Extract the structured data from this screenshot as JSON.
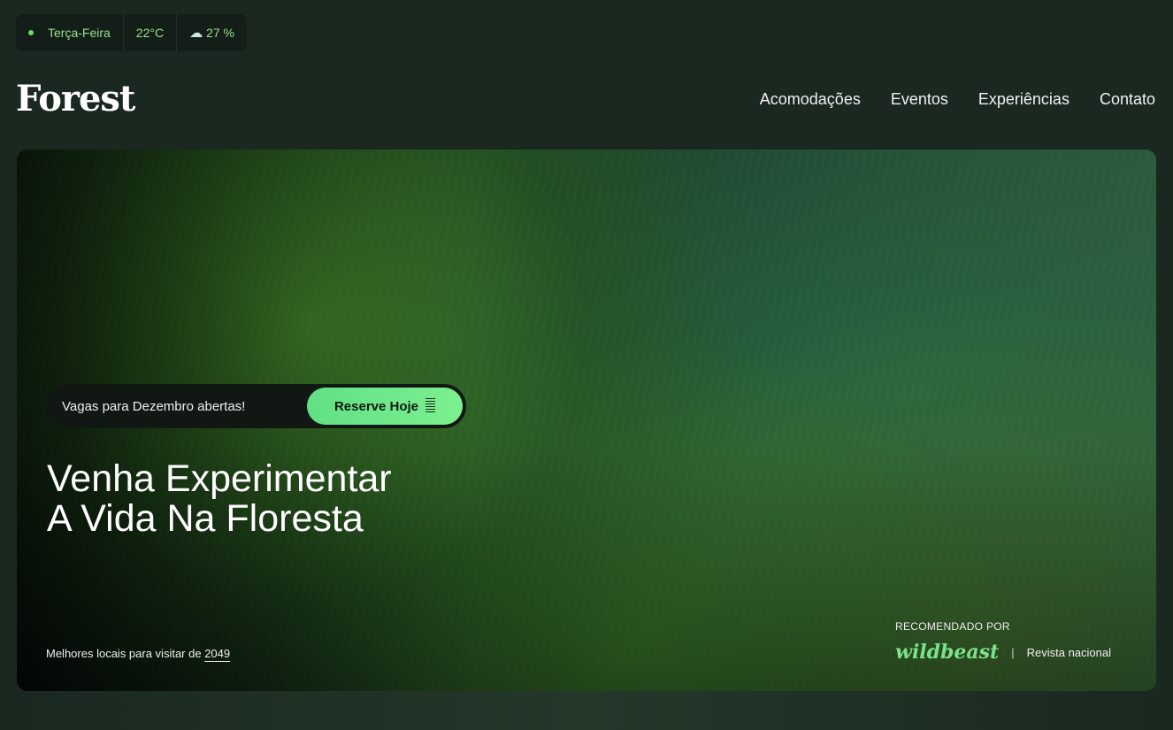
{
  "status_bar": {
    "day": "Terça-Feira",
    "temperature": "22°C",
    "rain_icon": "rain-cloud-icon",
    "rain": "27 %"
  },
  "brand": {
    "logo": "Forest"
  },
  "nav": {
    "items": [
      "Acomodações",
      "Eventos",
      "Experiências",
      "Contato"
    ]
  },
  "hero": {
    "promo_text": "Vagas para Dezembro abertas!",
    "cta_label": "Reserve Hoje",
    "headline_line1": "Venha Experimentar",
    "headline_line2": "A Vida Na Floresta",
    "best_places_text": "Melhores locais para visitar de",
    "best_places_year": "2049",
    "recommended_label": "RECOMENDADO POR",
    "recommended_brand": "wildbeast",
    "recommended_source": "Revista nacional"
  },
  "colors": {
    "accent": "#6ed86a",
    "cta": "#61e085",
    "background": "#1a2820"
  }
}
